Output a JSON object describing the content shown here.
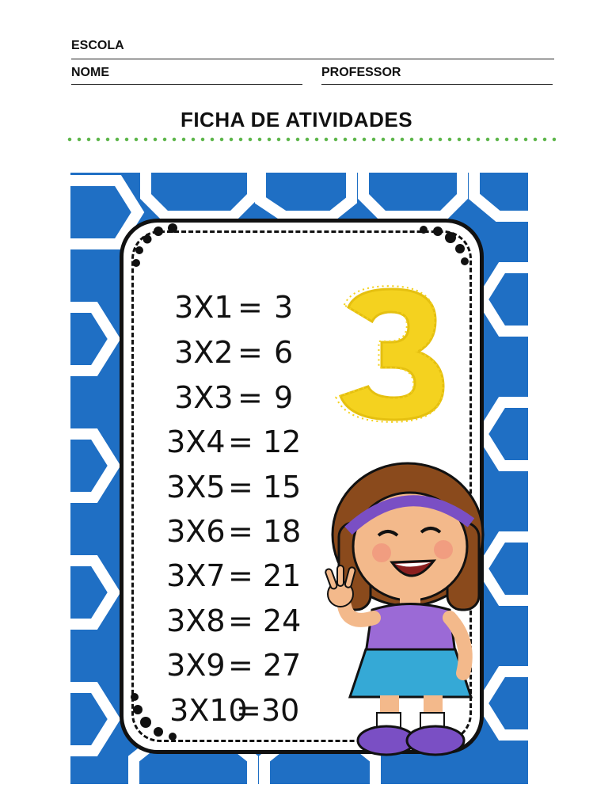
{
  "header": {
    "school_label": "ESCOLA",
    "name_label": "NOME",
    "teacher_label": "PROFESSOR"
  },
  "title": "FICHA DE ATIVIDADES",
  "table": {
    "rows": [
      {
        "expr": "3X1",
        "eq": "=",
        "result": "3"
      },
      {
        "expr": "3X2",
        "eq": "=",
        "result": "6"
      },
      {
        "expr": "3X3",
        "eq": "=",
        "result": "9"
      },
      {
        "expr": "3X4",
        "eq": "=",
        "result": "12"
      },
      {
        "expr": "3X5",
        "eq": "=",
        "result": "15"
      },
      {
        "expr": "3X6",
        "eq": "=",
        "result": "18"
      },
      {
        "expr": "3X7",
        "eq": "=",
        "result": "21"
      },
      {
        "expr": "3X8",
        "eq": "=",
        "result": "24"
      },
      {
        "expr": "3X9",
        "eq": "=",
        "result": "27"
      },
      {
        "expr": "3X10",
        "eq": "=",
        "result": "30"
      }
    ],
    "big_number": "3"
  },
  "colors": {
    "panel_blue": "#1f6fc4",
    "dot_green": "#5db64b",
    "number_yellow": "#f4d21f",
    "hair_brown": "#8a4a1c",
    "headband_purple": "#7a4fc4",
    "skirt_blue": "#35a9d6"
  },
  "icons": {
    "girl": "girl-illustration-icon",
    "big_number": "yellow-number-three-icon"
  }
}
